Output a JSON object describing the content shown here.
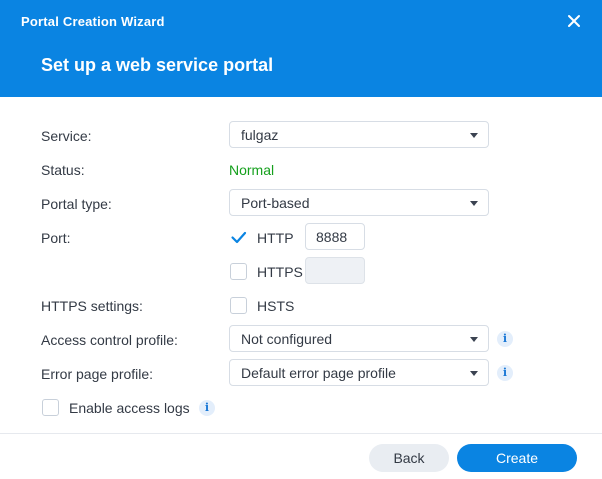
{
  "dialog": {
    "window_title": "Portal Creation Wizard",
    "page_title": "Set up a web service portal",
    "accent_color": "#0a84e2"
  },
  "form": {
    "service": {
      "label": "Service:",
      "value": "fulgaz"
    },
    "status": {
      "label": "Status:",
      "value": "Normal",
      "color": "#15a01d"
    },
    "portal_type": {
      "label": "Portal type:",
      "value": "Port-based"
    },
    "port": {
      "label": "Port:",
      "http": {
        "label": "HTTP",
        "checked": true,
        "value": "8888"
      },
      "https": {
        "label": "HTTPS",
        "checked": false,
        "value": ""
      }
    },
    "https_settings": {
      "label": "HTTPS settings:",
      "hsts": {
        "label": "HSTS",
        "checked": false
      }
    },
    "access_control_profile": {
      "label": "Access control profile:",
      "value": "Not configured"
    },
    "error_page_profile": {
      "label": "Error page profile:",
      "value": "Default error page profile"
    },
    "access_logs": {
      "label": "Enable access logs",
      "checked": false
    }
  },
  "footer": {
    "back_label": "Back",
    "create_label": "Create"
  },
  "icons": {
    "close": "close-icon",
    "info": "info-icon",
    "checkmark": "checkmark-icon",
    "dropdown": "chevron-down-icon"
  }
}
